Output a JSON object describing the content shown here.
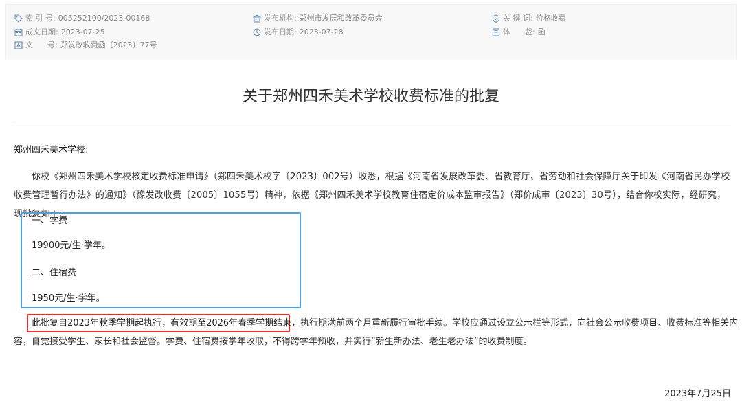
{
  "meta": {
    "index_label": "索 引 号:",
    "index_value": "005252100/2023-00168",
    "publisher_label": "发布机构:",
    "publisher_value": "郑州市发展和改革委员会",
    "keywords_label": "关 键 词:",
    "keywords_value": "价格收费",
    "created_label": "成文日期:",
    "created_value": "2023-07-25",
    "published_label": "发布日期:",
    "published_value": "2023-07-28",
    "genre_label": "体      裁:",
    "genre_value": "函",
    "docnum_label": "文      号:",
    "docnum_value": "郑发改收费函〔2023〕77号"
  },
  "doc": {
    "title": "关于郑州四禾美术学校收费标准的批复",
    "addressee": "郑州四禾美术学校:",
    "para1": "你校《郑州四禾美术学校核定收费标准申请》（郑四禾美术校字〔2023〕002号）收悉，根据《河南省发展改革委、省教育厅、省劳动和社会保障厅关于印发《河南省民办学校收费管理暂行办法》的通知》（豫发改收费〔2005〕1055号）精神，依据《郑州四禾美术学校教育住宿定价成本监审报告》（郑价成审〔2023〕30号），结合你校实际，经研究，现批复如下:",
    "fee1_heading": "一、学费",
    "fee1_value": "19900元/生·学年。",
    "fee2_heading": "二、住宿费",
    "fee2_value": "1950元/生·学年。",
    "para2_highlight": "此批复自2023年秋季学期起执行，有效期至2026年春季学期结束，",
    "para2_rest_line1": "执行期满前两个月重新履行审批手续。学校应通过设立公示栏等形式，向社会公示收费项目、收费标准等相关内",
    "para2_line2": "容，自觉接受学生、家长和社会监督。学费、住宿费按学年收取，不得跨学年预收，并实行“新生新办法、老生老办法”的收费制度。",
    "date": "2023年7月25日"
  },
  "colors": {
    "highlight_blue": "#4aa3e8",
    "highlight_red": "#e0322e"
  },
  "icons": {
    "index": "tag-icon",
    "publisher": "building-icon",
    "keywords": "shield-icon",
    "created": "calendar-icon",
    "published": "clock-icon",
    "genre": "list-icon",
    "docnum": "text-box-icon"
  }
}
